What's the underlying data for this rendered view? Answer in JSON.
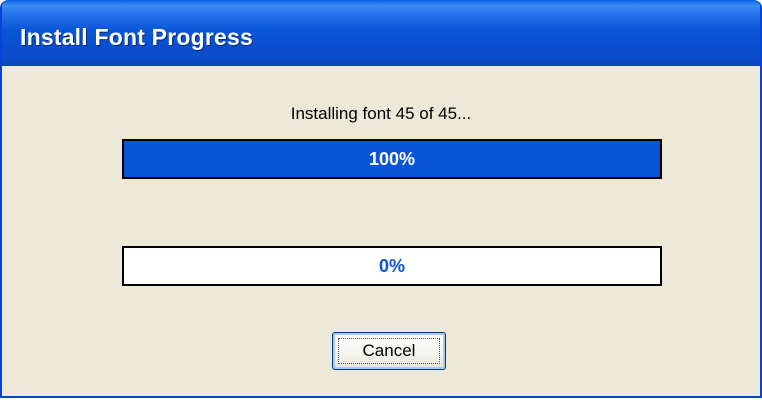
{
  "dialog": {
    "title": "Install Font Progress",
    "status": "Installing font 45 of 45...",
    "progress_overall": {
      "value": 1.0,
      "label": "100%"
    },
    "progress_current": {
      "value": 0.0,
      "label": "0%"
    },
    "cancel_label": "Cancel"
  },
  "colors": {
    "title_bar": "#0a54d6",
    "window_bg": "#ece9d8",
    "progress_fill": "#0a54d6",
    "progress_text_on_fill": "#ffffff",
    "progress_text_empty": "#0a54d6"
  }
}
